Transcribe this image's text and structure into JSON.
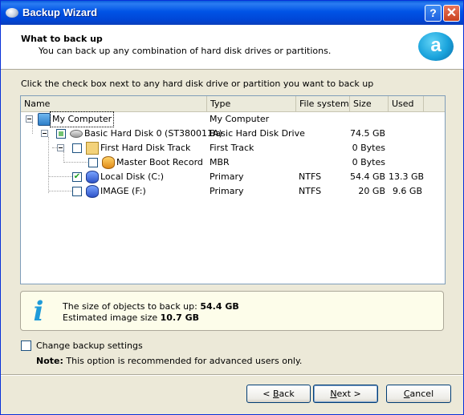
{
  "window": {
    "title": "Backup Wizard",
    "help_glyph": "?",
    "close_glyph": "✕"
  },
  "header": {
    "title": "What to back up",
    "subtitle": "You can back up any combination of hard disk drives or partitions."
  },
  "instruction": "Click the check box next to any hard disk drive or partition you want to back up",
  "table": {
    "columns": [
      "Name",
      "Type",
      "File system",
      "Size",
      "Used"
    ],
    "rows": [
      {
        "name": "My Computer",
        "type": "My Computer",
        "fs": "",
        "size": "",
        "used": "",
        "checked": "none",
        "icon": "computer-icon"
      },
      {
        "name": "Basic Hard Disk 0 (ST380011A)",
        "type": "Basic Hard Disk Drive",
        "fs": "",
        "size": "74.5 GB",
        "used": "",
        "checked": "partial",
        "icon": "hard-disk-icon"
      },
      {
        "name": "First Hard Disk Track",
        "type": "First Track",
        "fs": "",
        "size": "0 Bytes",
        "used": "",
        "checked": "unchecked",
        "icon": "track-icon"
      },
      {
        "name": "Master Boot Record",
        "type": "MBR",
        "fs": "",
        "size": "0 Bytes",
        "used": "",
        "checked": "unchecked",
        "icon": "mbr-icon"
      },
      {
        "name": "Local Disk (C:)",
        "type": "Primary",
        "fs": "NTFS",
        "size": "54.4 GB",
        "used": "13.3 GB",
        "checked": "checked",
        "icon": "partition-icon"
      },
      {
        "name": "IMAGE (F:)",
        "type": "Primary",
        "fs": "NTFS",
        "size": "20 GB",
        "used": "9.6 GB",
        "checked": "unchecked",
        "icon": "partition-icon"
      }
    ]
  },
  "info": {
    "size_label": "The size of objects to back up:",
    "size_value": "54.4 GB",
    "image_label": "Estimated image size",
    "image_value": "10.7 GB"
  },
  "settings": {
    "checkbox_label": "Change backup settings",
    "checked": false,
    "note_label": "Note:",
    "note_text": "This option is recommended for advanced users only."
  },
  "buttons": {
    "back_mnemonic": "B",
    "back_rest": "ack",
    "back_prefix": "< ",
    "next_mnemonic": "N",
    "next_rest": "ext >",
    "cancel_mnemonic": "C",
    "cancel_rest": "ancel"
  },
  "colors": {
    "titlebar": "#0053e6",
    "window_bg": "#ece9d8",
    "info_bg": "#fdfdea",
    "check_green": "#21a121"
  }
}
